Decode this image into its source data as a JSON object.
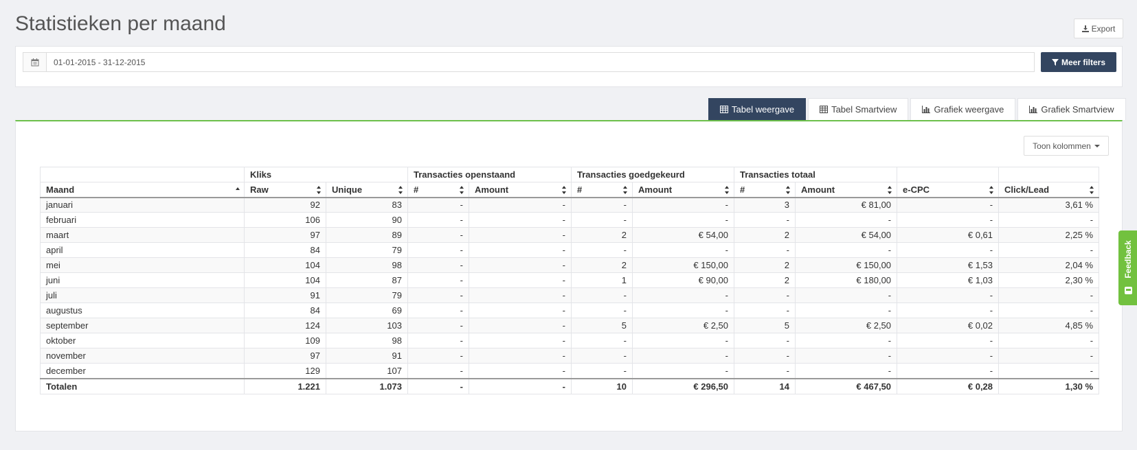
{
  "page": {
    "title": "Statistieken per maand"
  },
  "toolbar": {
    "export_label": "Export"
  },
  "filters": {
    "date_range_value": "01-01-2015 - 31-12-2015",
    "more_filters_label": "Meer filters"
  },
  "tabs": [
    {
      "label": "Tabel weergave",
      "icon": "table-icon",
      "active": true
    },
    {
      "label": "Tabel Smartview",
      "icon": "table-icon",
      "active": false
    },
    {
      "label": "Grafiek weergave",
      "icon": "bar-chart-icon",
      "active": false
    },
    {
      "label": "Grafiek Smartview",
      "icon": "bar-chart-icon",
      "active": false
    }
  ],
  "columns_toggle": {
    "label": "Toon kolommen"
  },
  "table": {
    "group_headers": [
      "",
      "Kliks",
      "Transacties openstaand",
      "Transacties goedgekeurd",
      "Transacties totaal",
      "",
      ""
    ],
    "columns": [
      "Maand",
      "Raw",
      "Unique",
      "#",
      "Amount",
      "#",
      "Amount",
      "#",
      "Amount",
      "e-CPC",
      "Click/Lead"
    ],
    "rows": [
      [
        "januari",
        "92",
        "83",
        "-",
        "-",
        "-",
        "-",
        "3",
        "€ 81,00",
        "-",
        "3,61 %"
      ],
      [
        "februari",
        "106",
        "90",
        "-",
        "-",
        "-",
        "-",
        "-",
        "-",
        "-",
        "-"
      ],
      [
        "maart",
        "97",
        "89",
        "-",
        "-",
        "2",
        "€ 54,00",
        "2",
        "€ 54,00",
        "€ 0,61",
        "2,25 %"
      ],
      [
        "april",
        "84",
        "79",
        "-",
        "-",
        "-",
        "-",
        "-",
        "-",
        "-",
        "-"
      ],
      [
        "mei",
        "104",
        "98",
        "-",
        "-",
        "2",
        "€ 150,00",
        "2",
        "€ 150,00",
        "€ 1,53",
        "2,04 %"
      ],
      [
        "juni",
        "104",
        "87",
        "-",
        "-",
        "1",
        "€ 90,00",
        "2",
        "€ 180,00",
        "€ 1,03",
        "2,30 %"
      ],
      [
        "juli",
        "91",
        "79",
        "-",
        "-",
        "-",
        "-",
        "-",
        "-",
        "-",
        "-"
      ],
      [
        "augustus",
        "84",
        "69",
        "-",
        "-",
        "-",
        "-",
        "-",
        "-",
        "-",
        "-"
      ],
      [
        "september",
        "124",
        "103",
        "-",
        "-",
        "5",
        "€ 2,50",
        "5",
        "€ 2,50",
        "€ 0,02",
        "4,85 %"
      ],
      [
        "oktober",
        "109",
        "98",
        "-",
        "-",
        "-",
        "-",
        "-",
        "-",
        "-",
        "-"
      ],
      [
        "november",
        "97",
        "91",
        "-",
        "-",
        "-",
        "-",
        "-",
        "-",
        "-",
        "-"
      ],
      [
        "december",
        "129",
        "107",
        "-",
        "-",
        "-",
        "-",
        "-",
        "-",
        "-",
        "-"
      ]
    ],
    "totals": [
      "Totalen",
      "1.221",
      "1.073",
      "-",
      "-",
      "10",
      "€ 296,50",
      "14",
      "€ 467,50",
      "€ 0,28",
      "1,30 %"
    ]
  },
  "feedback": {
    "label": "Feedback"
  },
  "colors": {
    "primary": "#334560",
    "accent_green": "#6cc04a",
    "feedback_green": "#72c13f"
  }
}
